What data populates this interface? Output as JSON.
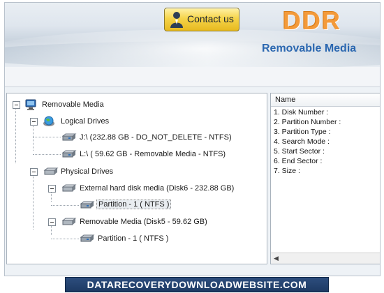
{
  "header": {
    "contact_label": "Contact us",
    "logo": "DDR",
    "subtitle": "Removable Media"
  },
  "tree": {
    "root": "Removable Media",
    "logical": "Logical Drives",
    "drive_j": "J:\\ (232.88 GB - DO_NOT_DELETE - NTFS)",
    "drive_l": "L:\\ ( 59.62 GB - Removable Media - NTFS)",
    "physical": "Physical Drives",
    "disk6": "External hard disk media (Disk6 - 232.88 GB)",
    "disk6_part": "Partition - 1 ( NTFS )",
    "disk5": "Removable Media (Disk5 - 59.62 GB)",
    "disk5_part": "Partition - 1 ( NTFS )"
  },
  "details": {
    "header": "Name",
    "items": [
      "1. Disk Number :",
      "2. Partition Number :",
      "3. Partition Type :",
      "4. Search Mode :",
      "5. Start Sector :",
      "6. End Sector :",
      "7. Size :"
    ]
  },
  "footer": {
    "label": "DATARECOVERYDOWNLOADWEBSITE.COM"
  },
  "colors": {
    "logo": "#f39a3a",
    "subtitle": "#2b67b0",
    "contact_button": "#f5d44a",
    "footer_bg": "#1d3a63"
  }
}
